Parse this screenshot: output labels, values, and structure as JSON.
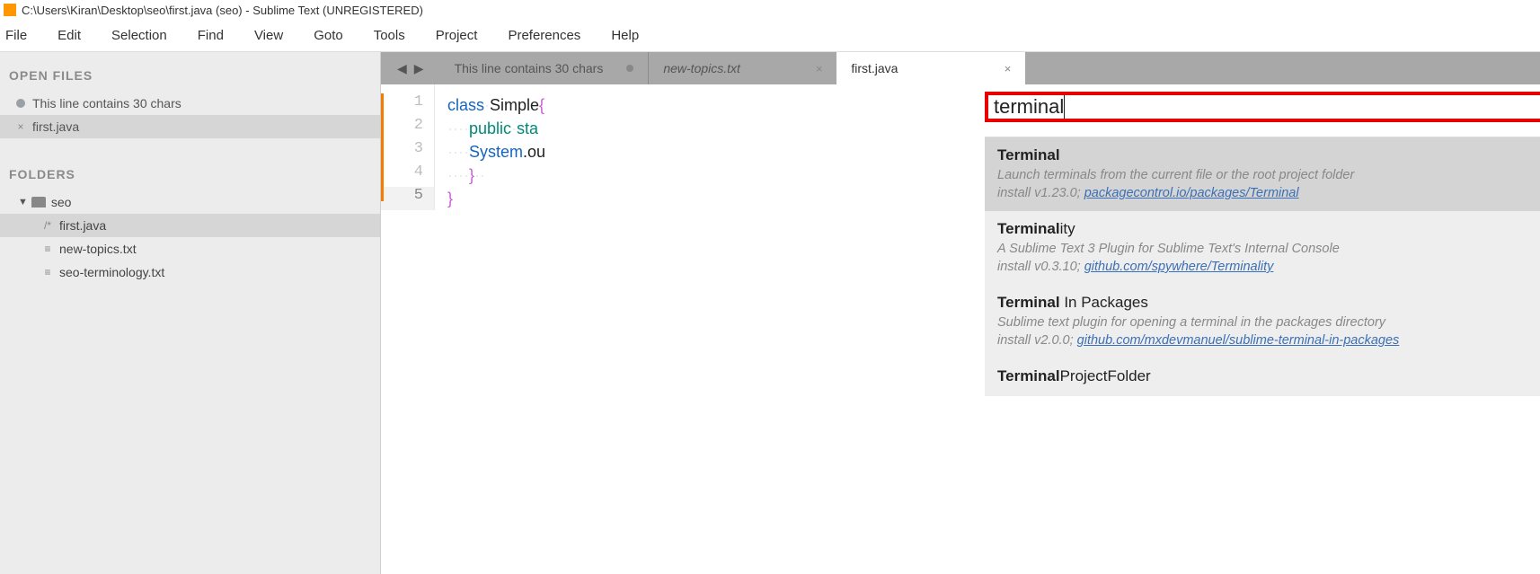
{
  "window": {
    "title": "C:\\Users\\Kiran\\Desktop\\seo\\first.java (seo) - Sublime Text (UNREGISTERED)"
  },
  "menubar": [
    "File",
    "Edit",
    "Selection",
    "Find",
    "View",
    "Goto",
    "Tools",
    "Project",
    "Preferences",
    "Help"
  ],
  "sidebar": {
    "open_files_heading": "OPEN FILES",
    "open_files": [
      {
        "label": "This line contains 30 chars",
        "dirty": true,
        "active": false
      },
      {
        "label": "first.java",
        "dirty": false,
        "active": true
      }
    ],
    "folders_heading": "FOLDERS",
    "folder_name": "seo",
    "files": [
      {
        "label": "first.java",
        "icon": "/*",
        "selected": true
      },
      {
        "label": "new-topics.txt",
        "icon": "≡",
        "selected": false
      },
      {
        "label": "seo-terminology.txt",
        "icon": "≡",
        "selected": false
      }
    ]
  },
  "tabs": {
    "t0": "This line contains 30 chars",
    "t1": "new-topics.txt",
    "t2": "first.java"
  },
  "gutter": [
    "1",
    "2",
    "3",
    "4",
    "5"
  ],
  "code": {
    "l1a": "class",
    "l1b": "Simple",
    "l1c": "{",
    "l2a": "public",
    "l2b": "sta",
    "l3a": "System",
    "l3b": ".ou",
    "l4": "}",
    "l5": "}"
  },
  "palette": {
    "query": "terminal",
    "items": [
      {
        "title_bold": "Terminal",
        "title_rest": "",
        "desc": "Launch terminals from the current file or the root project folder",
        "install": "install v1.23.0; ",
        "link": "packagecontrol.io/packages/Terminal",
        "selected": true
      },
      {
        "title_bold": "Terminal",
        "title_rest": "ity",
        "desc": "A Sublime Text 3 Plugin for Sublime Text's Internal Console",
        "install": "install v0.3.10; ",
        "link": "github.com/spywhere/Terminality",
        "selected": false
      },
      {
        "title_bold": "Terminal",
        "title_rest": " In Packages",
        "desc": "Sublime text plugin for opening a terminal in the packages directory",
        "install": "install v2.0.0; ",
        "link": "github.com/mxdevmanuel/sublime-terminal-in-packages",
        "selected": false
      },
      {
        "title_bold": "Terminal",
        "title_rest": "ProjectFolder",
        "desc": "",
        "install": "",
        "link": "",
        "selected": false
      }
    ]
  }
}
